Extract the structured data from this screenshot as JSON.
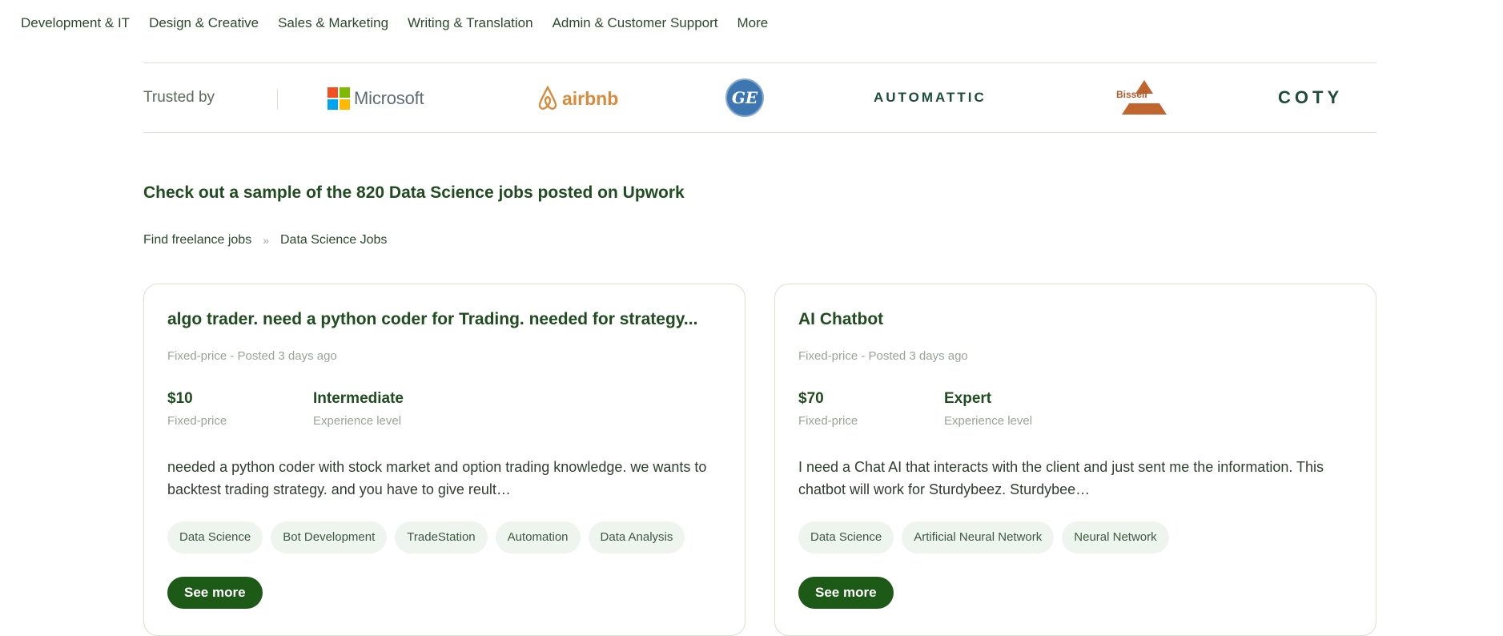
{
  "nav": {
    "items": [
      "Development & IT",
      "Design & Creative",
      "Sales & Marketing",
      "Writing & Translation",
      "Admin & Customer Support",
      "More"
    ]
  },
  "trusted": {
    "label": "Trusted by",
    "logos": {
      "microsoft": "Microsoft",
      "airbnb": "airbnb",
      "ge": "GE",
      "automattic": "AUTOMATTIC",
      "bissell": "Bissell",
      "coty": "COTY"
    },
    "colors": {
      "ms_red": "#f25022",
      "ms_green": "#7fba00",
      "ms_blue": "#00a4ef",
      "ms_yellow": "#ffb900"
    }
  },
  "heading": "Check out a sample of the 820 Data Science jobs posted on Upwork",
  "breadcrumb": {
    "home": "Find freelance jobs",
    "separator": "»",
    "current": "Data Science Jobs"
  },
  "jobs": [
    {
      "title": "algo trader. need a python coder for Trading. needed for strategy...",
      "meta": "Fixed-price - Posted 3 days ago",
      "price": "$10",
      "price_label": "Fixed-price",
      "level": "Intermediate",
      "level_label": "Experience level",
      "description": "needed a python coder with stock market and option trading knowledge. we wants to backtest trading strategy. and you have to give reult…",
      "tags": [
        "Data Science",
        "Bot Development",
        "TradeStation",
        "Automation",
        "Data Analysis"
      ],
      "button": "See more"
    },
    {
      "title": "AI Chatbot",
      "meta": "Fixed-price - Posted 3 days ago",
      "price": "$70",
      "price_label": "Fixed-price",
      "level": "Expert",
      "level_label": "Experience level",
      "description": "I need a Chat AI that interacts with the client and just sent me the information. This chatbot will work for Sturdybeez. Sturdybee…",
      "tags": [
        "Data Science",
        "Artificial Neural Network",
        "Neural Network"
      ],
      "button": "See more"
    }
  ],
  "theme": {
    "accent": "#1e5a17",
    "heading": "#1f4d1f",
    "muted": "#97a697",
    "border": "#d7e2d3",
    "tag_bg": "#eef4ee"
  }
}
